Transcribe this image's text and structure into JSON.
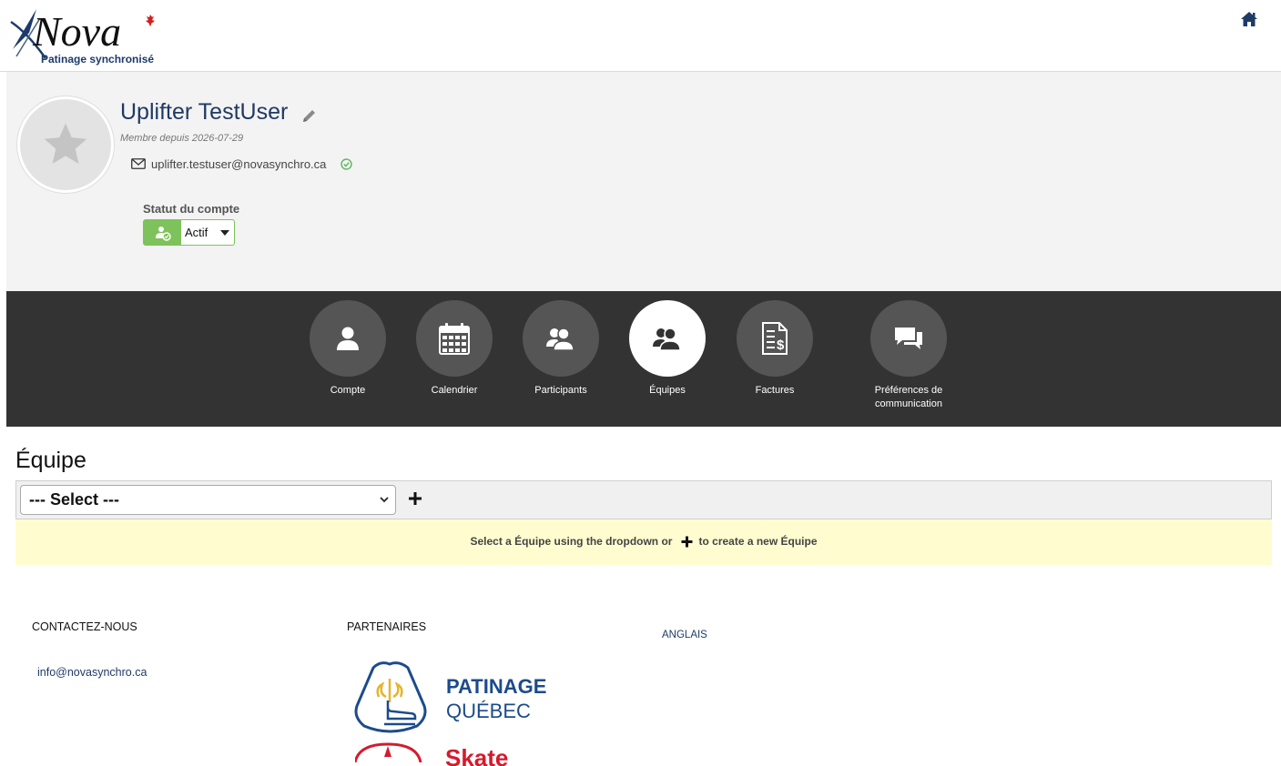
{
  "header": {
    "logo_text": "Nova",
    "logo_subtitle": "Patinage synchronisé",
    "home_icon": "home-icon"
  },
  "profile": {
    "name": "Uplifter TestUser",
    "member_since": "Membre depuis 2026-07-29",
    "email": "uplifter.testuser@novasynchro.ca",
    "status_label": "Statut du compte",
    "status_value": "Actif",
    "colors": {
      "name": "#1f3a66",
      "status_green": "#7dc25a"
    }
  },
  "nav": {
    "items": [
      {
        "label": "Compte",
        "icon": "user-icon"
      },
      {
        "label": "Calendrier",
        "icon": "calendar-icon"
      },
      {
        "label": "Participants",
        "icon": "users-icon"
      },
      {
        "label": "Équipes",
        "icon": "team-icon",
        "active": true
      },
      {
        "label": "Factures",
        "icon": "invoice-icon"
      },
      {
        "label": "Préférences de communication",
        "icon": "chat-icon"
      }
    ],
    "colors": {
      "bar": "#333333",
      "circle": "#555555",
      "active_circle": "#ffffff"
    }
  },
  "team": {
    "title": "Équipe",
    "select_value": "--- Select ---",
    "add_label": "+",
    "info_before": "Select a Équipe using the dropdown or",
    "info_after": "to create a new Équipe"
  },
  "footer": {
    "contact_heading": "CONTACTEZ-NOUS",
    "contact_email": "info@novasynchro.ca",
    "partners_heading": "PARTENAIRES",
    "language_link": "ANGLAIS",
    "partner_logos": [
      {
        "name": "Patinage Québec",
        "line1": "PATINAGE",
        "line2": "QUÉBEC"
      },
      {
        "name": "Skate Canada",
        "line1": "Skate"
      }
    ]
  }
}
